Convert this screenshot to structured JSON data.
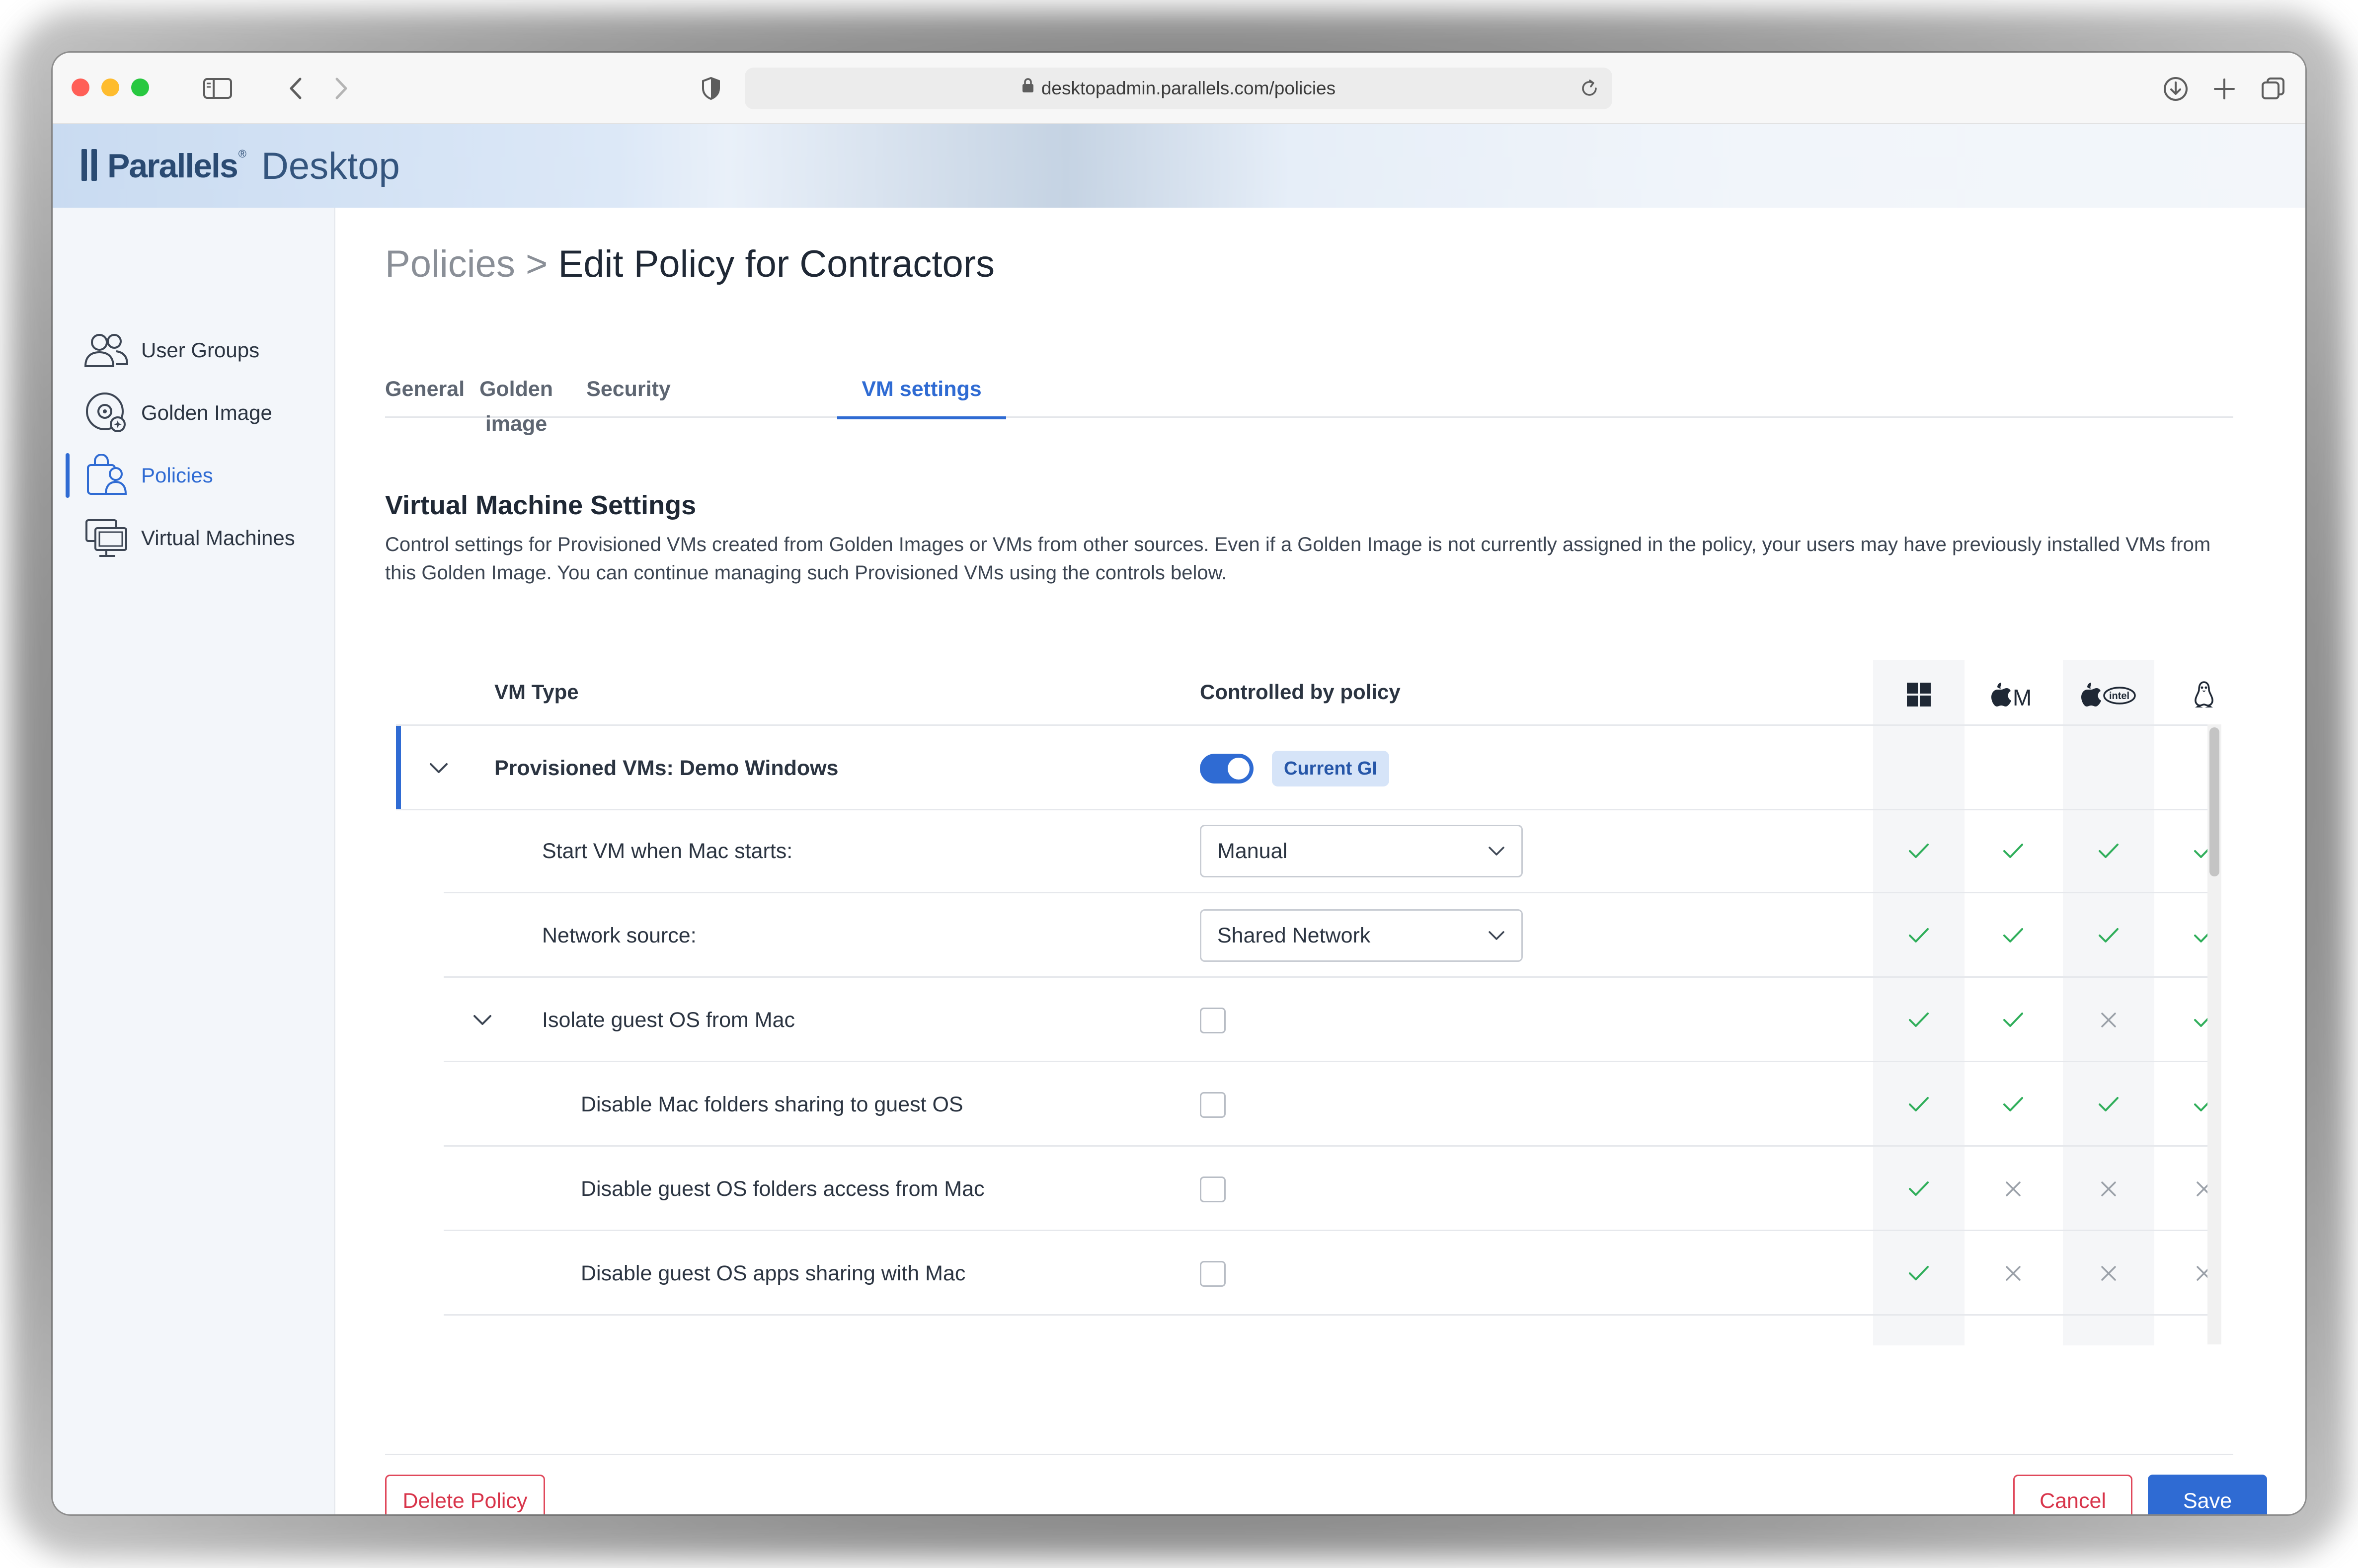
{
  "browser": {
    "url": "desktopadmin.parallels.com/policies",
    "traffic_light_colors": [
      "#ff5f57",
      "#febc2e",
      "#28c840"
    ]
  },
  "brand": {
    "name": "Parallels",
    "reg": "®",
    "product": "Desktop"
  },
  "sidebar": {
    "items": [
      {
        "label": "User Groups",
        "icon": "user-groups-icon",
        "active": false
      },
      {
        "label": "Golden Image",
        "icon": "golden-image-icon",
        "active": false
      },
      {
        "label": "Policies",
        "icon": "policies-icon",
        "active": true
      },
      {
        "label": "Virtual Machines",
        "icon": "virtual-machines-icon",
        "active": false
      }
    ]
  },
  "page": {
    "breadcrumb_parent": "Policies",
    "breadcrumb_separator": ">",
    "title": "Edit Policy for Contractors"
  },
  "tabs": [
    {
      "label": "General",
      "active": false
    },
    {
      "label": "Golden image",
      "active": false
    },
    {
      "label": "Security",
      "active": false
    },
    {
      "label": "VM settings",
      "active": true
    }
  ],
  "section": {
    "title": "Virtual Machine Settings",
    "description": "Control settings for Provisioned VMs created from Golden Images or VMs from other sources. Even if a Golden Image is not currently assigned in the policy, your users may have previously installed VMs from this Golden Image. You can continue managing such Provisioned VMs using the controls below."
  },
  "table": {
    "col_vm_type": "VM Type",
    "col_controlled": "Controlled by policy",
    "os_columns": [
      "windows-icon",
      "apple-m-icon",
      "apple-intel-icon",
      "linux-icon"
    ],
    "group": {
      "label": "Provisioned VMs:  Demo Windows",
      "toggle_on": true,
      "badge": "Current GI"
    },
    "rows": [
      {
        "label": "Start VM when Mac starts:",
        "control": "select",
        "value": "Manual",
        "support": [
          true,
          true,
          true,
          true
        ]
      },
      {
        "label": "Network source:",
        "control": "select",
        "value": "Shared Network",
        "support": [
          true,
          true,
          true,
          true
        ]
      },
      {
        "label": "Isolate guest OS from Mac",
        "control": "checkbox",
        "checked": false,
        "expandable": true,
        "support": [
          true,
          true,
          false,
          true
        ]
      },
      {
        "label": "Disable Mac folders sharing to guest OS",
        "control": "checkbox",
        "checked": false,
        "support": [
          true,
          true,
          true,
          true
        ]
      },
      {
        "label": "Disable guest OS folders access from Mac",
        "control": "checkbox",
        "checked": false,
        "support": [
          true,
          false,
          false,
          false
        ]
      },
      {
        "label": "Disable guest OS apps sharing with Mac",
        "control": "checkbox",
        "checked": false,
        "support": [
          true,
          false,
          false,
          false
        ]
      }
    ]
  },
  "footer": {
    "delete_label": "Delete Policy",
    "cancel_label": "Cancel",
    "save_label": "Save"
  },
  "colors": {
    "accent": "#2f6bd3",
    "check": "#2fae5a",
    "cross": "#9aa0a8",
    "danger": "#d8344a"
  }
}
